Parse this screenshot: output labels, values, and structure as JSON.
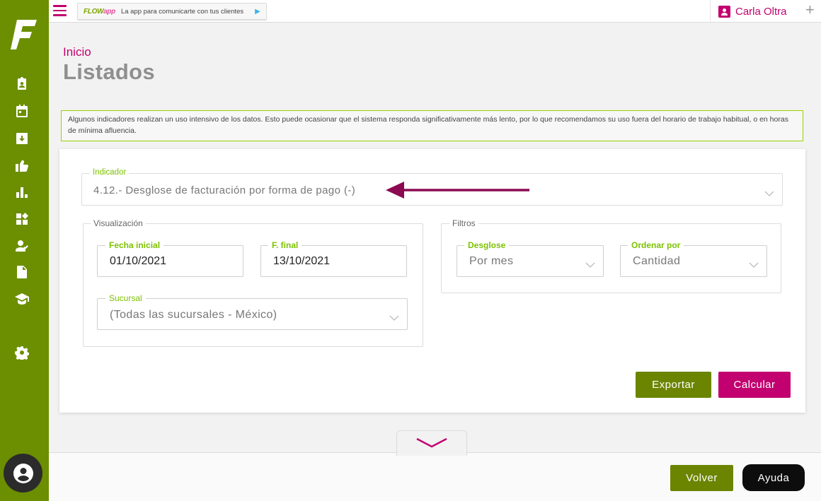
{
  "topbar": {
    "promo_brand": "FLOW",
    "promo_brand_suffix": "app",
    "promo_text": "La app para comunicarte con tus clientes",
    "user_name": "Carla Oltra"
  },
  "header": {
    "breadcrumb": "Inicio",
    "title": "Listados"
  },
  "notice": "Algunos indicadores realizan un uso intensivo de los datos. Esto puede ocasionar que el sistema responda significativamente más lento, por lo que recomendamos su uso fuera del horario de trabajo habitual, o en horas de mínima afluencia.",
  "form": {
    "indicador": {
      "label": "Indicador",
      "value": "4.12.- Desglose de facturación por forma de pago (-)"
    },
    "visualizacion": {
      "legend": "Visualización",
      "fecha_inicial_label": "Fecha inicial",
      "fecha_inicial_value": "01/10/2021",
      "fecha_final_label": "F. final",
      "fecha_final_value": "13/10/2021",
      "sucursal_label": "Sucursal",
      "sucursal_value": "(Todas las sucursales - México)"
    },
    "filtros": {
      "legend": "Filtros",
      "desglose_label": "Desglose",
      "desglose_value": "Por mes",
      "ordenar_label": "Ordenar por",
      "ordenar_value": "Cantidad"
    },
    "export_label": "Exportar",
    "calc_label": "Calcular"
  },
  "footer": {
    "back_label": "Volver",
    "help_label": "Ayuda"
  },
  "colors": {
    "sidebar": "#6b8f00",
    "accent": "#c2006f",
    "olive_button": "#6b8500",
    "label_green": "#7dc200"
  },
  "sidebar_icons": [
    "clipboard-user-icon",
    "calendar-icon",
    "inbox-icon",
    "thumbs-up-icon",
    "bar-chart-icon",
    "widgets-icon",
    "user-check-icon",
    "document-icon",
    "graduation-cap-icon",
    "gear-icon"
  ]
}
